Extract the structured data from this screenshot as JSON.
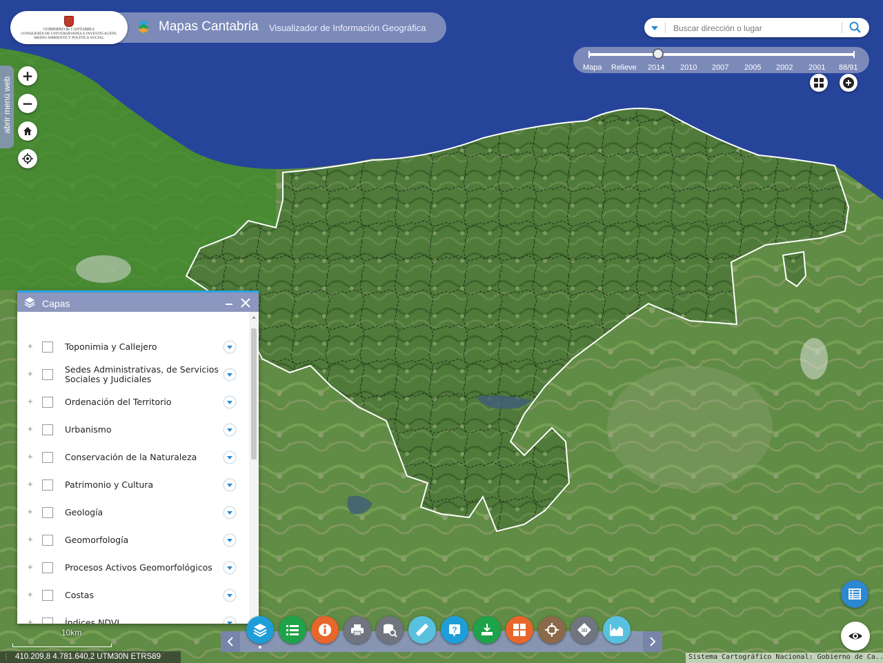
{
  "header": {
    "logo_line1": "GOBIERNO de CANTABRIA",
    "logo_line2": "CONSEJERÍA DE UNIVERSIDADES E INVESTIGACIÓN,",
    "logo_line3": "MEDIO AMBIENTE Y POLÍTICA SOCIAL",
    "title": "Mapas Cantabria",
    "subtitle": "Visualizador de Información Geográfica"
  },
  "search": {
    "placeholder": "Buscar dirección o lugar",
    "value": ""
  },
  "side_menu": {
    "label": "abrir menú web"
  },
  "map_controls": {
    "zoom_in": "+",
    "zoom_out": "−",
    "home_icon": "home-icon",
    "locate_icon": "locate-icon"
  },
  "timeline": {
    "labels": [
      "Mapa",
      "Relieve",
      "2014",
      "2010",
      "2007",
      "2005",
      "2002",
      "2001",
      "88/91"
    ],
    "selected": "2014"
  },
  "layers_panel": {
    "title": "Capas",
    "items": [
      {
        "label": "Toponimia y Callejero"
      },
      {
        "label": "Sedes Administrativas, de Servicios Sociales y Judiciales"
      },
      {
        "label": "Ordenación del Territorio"
      },
      {
        "label": "Urbanismo"
      },
      {
        "label": "Conservación de la Naturaleza"
      },
      {
        "label": "Patrimonio y Cultura"
      },
      {
        "label": "Geología"
      },
      {
        "label": "Geomorfología"
      },
      {
        "label": "Procesos Activos Geomorfológicos"
      },
      {
        "label": "Costas"
      },
      {
        "label": "Índices NDVI"
      }
    ]
  },
  "toolbar": {
    "tools": [
      {
        "name": "layers",
        "color": "#1e9ed8"
      },
      {
        "name": "list",
        "color": "#1ea34a"
      },
      {
        "name": "info",
        "color": "#e8662a"
      },
      {
        "name": "print",
        "color": "#707580"
      },
      {
        "name": "query",
        "color": "#707580"
      },
      {
        "name": "measure",
        "color": "#59c1e0"
      },
      {
        "name": "help",
        "color": "#1e9ed8"
      },
      {
        "name": "download",
        "color": "#1ea34a"
      },
      {
        "name": "grid",
        "color": "#e8662a"
      },
      {
        "name": "coordinates",
        "color": "#8a6a4a"
      },
      {
        "name": "3d",
        "color": "#707580"
      },
      {
        "name": "profile",
        "color": "#59c1e0"
      }
    ]
  },
  "scale": {
    "label": "10km"
  },
  "coordinates": {
    "text": "410.209,8 4.781.640,2 UTM30N ETRS89"
  },
  "attribution": {
    "text": "Sistema Cartográfico Nacional: Gobierno de Ca..."
  }
}
